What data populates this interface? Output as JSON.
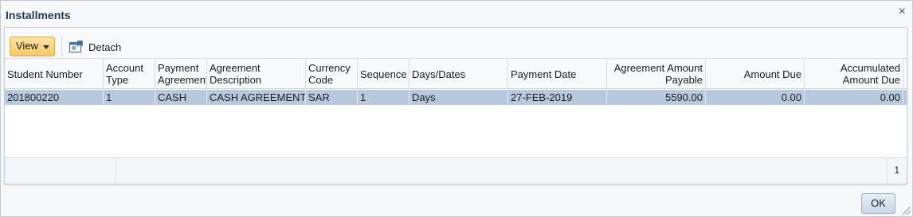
{
  "dialog": {
    "title": "Installments",
    "close_glyph": "×",
    "ok_label": "OK"
  },
  "toolbar": {
    "view_label": "View",
    "detach_label": "Detach",
    "detach_icon": "detach-window-icon"
  },
  "table": {
    "columns": [
      {
        "label": "Student Number"
      },
      {
        "label": "Account Type"
      },
      {
        "label": "Payment Agreement"
      },
      {
        "label": "Agreement Description"
      },
      {
        "label": "Currency Code"
      },
      {
        "label": "Sequence"
      },
      {
        "label": "Days/Dates"
      },
      {
        "label": "Payment Date"
      },
      {
        "label": "Agreement Amount Payable"
      },
      {
        "label": "Amount Due"
      },
      {
        "label": "Accumulated Amount Due"
      }
    ],
    "rows": [
      {
        "student_number": "201800220",
        "account_type": "1",
        "payment_agreement": "CASH",
        "agreement_description": "CASH AGREEMENT",
        "currency_code": "SAR",
        "sequence": "1",
        "days_dates": "Days",
        "payment_date": "27-FEB-2019",
        "agreement_amount_payable": "5590.00",
        "amount_due": "0.00",
        "accumulated_amount_due": "0.00"
      }
    ],
    "row_count": "1"
  },
  "colors": {
    "selected_row": "#b8c9df",
    "title_text": "#1f3b58",
    "view_button": "#f7c869"
  }
}
